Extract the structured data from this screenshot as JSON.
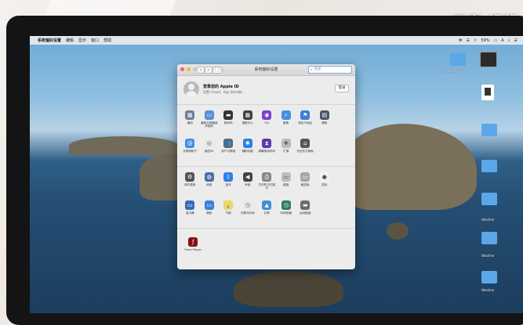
{
  "watermark": "天奇·视频",
  "menubar": {
    "app": "系统偏好设置",
    "items": [
      "编辑",
      "显示",
      "窗口",
      "帮助"
    ],
    "status": [
      "⌘",
      "☰",
      "⇧",
      "59%",
      "▭",
      "A",
      "⌕",
      "☰"
    ]
  },
  "desktop": {
    "labels": [
      "20191203",
      "Weather",
      "Weather",
      "Weather"
    ]
  },
  "window": {
    "title": "系统偏好设置",
    "search_placeholder": "搜索",
    "account_title": "登录您的 Apple ID",
    "account_sub": "设置 iCloud、App Store和...",
    "login_label": "登录",
    "back": "‹",
    "forward": "›",
    "grid": "⋮⋮⋮"
  },
  "prefs_row1": [
    {
      "name": "general",
      "label": "通用",
      "color": "#6e7f95",
      "glyph": "▦"
    },
    {
      "name": "desktop",
      "label": "桌面与屏幕保护程序",
      "color": "#5a8fd6",
      "glyph": "▭"
    },
    {
      "name": "dock",
      "label": "程序坞",
      "color": "#333333",
      "glyph": "▬"
    },
    {
      "name": "mission-control",
      "label": "调度中心",
      "color": "#3f3f3f",
      "glyph": "▦"
    },
    {
      "name": "siri",
      "label": "Siri",
      "color": "#7b3fd1",
      "glyph": "◉"
    },
    {
      "name": "spotlight",
      "label": "聚焦",
      "color": "#4a8fe0",
      "glyph": "⌕"
    },
    {
      "name": "language",
      "label": "语言与地区",
      "color": "#3a7fd6",
      "glyph": "⚑"
    },
    {
      "name": "notifications",
      "label": "通知",
      "color": "#4d5566",
      "glyph": "▤"
    }
  ],
  "prefs_row2": [
    {
      "name": "internet-accounts",
      "label": "互联网帐户",
      "color": "#3d8fe8",
      "glyph": "@"
    },
    {
      "name": "touch-id",
      "label": "触控ID",
      "color": "#e8e8e8",
      "glyph": "◎"
    },
    {
      "name": "users-groups",
      "label": "用户与群组",
      "color": "#666666",
      "glyph": "👥"
    },
    {
      "name": "accessibility",
      "label": "辅助功能",
      "color": "#2f7fe3",
      "glyph": "✱"
    },
    {
      "name": "screen-time",
      "label": "屏幕使用时间",
      "color": "#5b3aa8",
      "glyph": "⧗"
    },
    {
      "name": "extensions",
      "label": "扩展",
      "color": "#bbbbbb",
      "glyph": "✚"
    },
    {
      "name": "security",
      "label": "安全性与隐私",
      "color": "#555555",
      "glyph": "⌂"
    }
  ],
  "prefs_row3": [
    {
      "name": "software-update",
      "label": "软件更新",
      "color": "#555555",
      "glyph": "⚙"
    },
    {
      "name": "network",
      "label": "网络",
      "color": "#4a6fa8",
      "glyph": "◍"
    },
    {
      "name": "bluetooth",
      "label": "蓝牙",
      "color": "#2f82e8",
      "glyph": "ᛒ"
    },
    {
      "name": "sound",
      "label": "声音",
      "color": "#444444",
      "glyph": "◀"
    },
    {
      "name": "printers",
      "label": "打印机与扫描仪",
      "color": "#888888",
      "glyph": "⎙"
    },
    {
      "name": "keyboard",
      "label": "键盘",
      "color": "#bdbdbd",
      "glyph": "▭"
    },
    {
      "name": "trackpad",
      "label": "触控板",
      "color": "#a8a8a8",
      "glyph": "▭"
    },
    {
      "name": "mouse",
      "label": "鼠标",
      "color": "#f2f2f2",
      "glyph": "●"
    }
  ],
  "prefs_row4": [
    {
      "name": "displays",
      "label": "显示器",
      "color": "#3b6bb8",
      "glyph": "▭"
    },
    {
      "name": "sidecar",
      "label": "随航",
      "color": "#3e7fd8",
      "glyph": "▭"
    },
    {
      "name": "energy",
      "label": "节能",
      "color": "#e8d47a",
      "glyph": "💡"
    },
    {
      "name": "date-time",
      "label": "日期与时间",
      "color": "#e9e9e9",
      "glyph": "◷"
    },
    {
      "name": "sharing",
      "label": "共享",
      "color": "#3e8fd8",
      "glyph": "▲"
    },
    {
      "name": "time-machine",
      "label": "时间机器",
      "color": "#2f7d62",
      "glyph": "◷"
    },
    {
      "name": "startup-disk",
      "label": "启动磁盘",
      "color": "#6b6b6b",
      "glyph": "▬"
    }
  ],
  "prefs_other": [
    {
      "name": "flash-player",
      "label": "Flash Player",
      "color": "#8a1010",
      "glyph": "ƒ"
    }
  ]
}
